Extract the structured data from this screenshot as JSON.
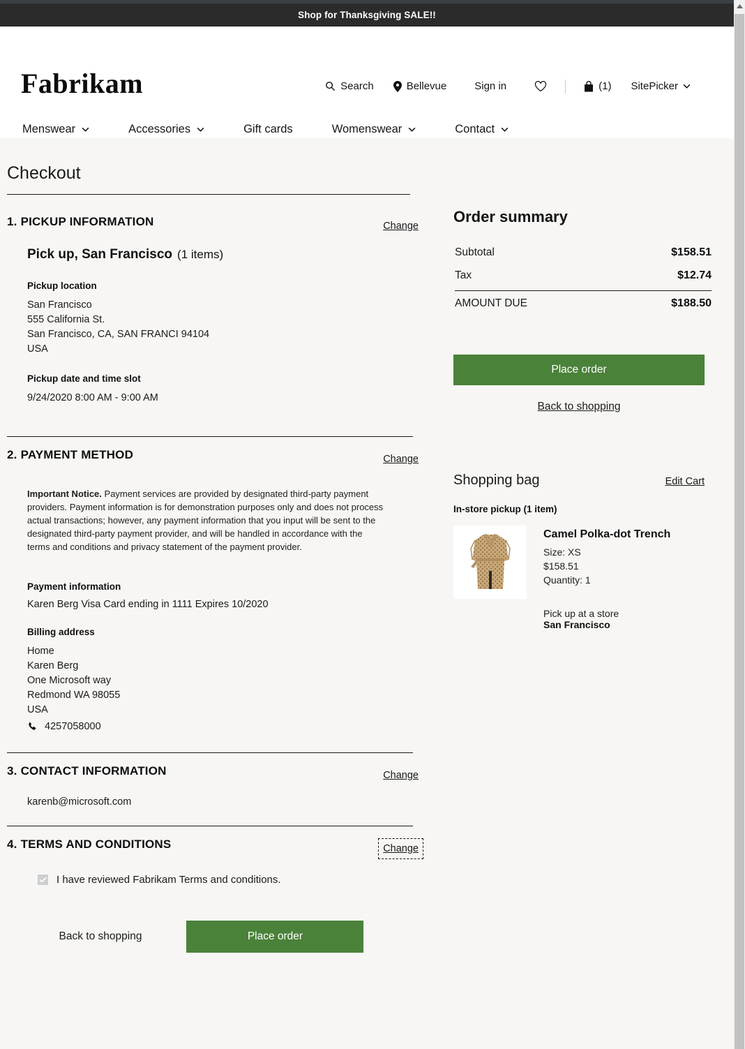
{
  "promo": {
    "text": "Shop for Thanksgiving SALE!!"
  },
  "header": {
    "logo": "Fabrikam",
    "utils": {
      "search": "Search",
      "location": "Bellevue",
      "signin": "Sign in",
      "cart_count": "(1)",
      "sitepicker": "SitePicker"
    },
    "nav": [
      {
        "label": "Menswear",
        "has_chevron": true
      },
      {
        "label": "Accessories",
        "has_chevron": true
      },
      {
        "label": "Gift cards",
        "has_chevron": false
      },
      {
        "label": "Womenswear",
        "has_chevron": true
      },
      {
        "label": "Contact",
        "has_chevron": true
      }
    ]
  },
  "checkout": {
    "title": "Checkout",
    "sections": {
      "pickup": {
        "number": "1.",
        "title": "PICKUP INFORMATION",
        "change": "Change",
        "heading": "Pick up, San Francisco",
        "items_count": "(1 items)",
        "location_label": "Pickup location",
        "location_lines": [
          "San Francisco",
          "555 California St.",
          "San Francisco, CA, SAN FRANCI 94104",
          "USA"
        ],
        "datetime_label": "Pickup date and time slot",
        "datetime_value": "9/24/2020 8:00 AM - 9:00 AM"
      },
      "payment": {
        "number": "2.",
        "title": "PAYMENT METHOD",
        "change": "Change",
        "notice_bold": "Important Notice.",
        "notice_body": " Payment services are provided by designated third-party payment providers.  Payment information is for demonstration purposes only and does not process actual transactions; however, any payment information that you input will be sent to the designated third-party payment provider, and will be handled in accordance with the terms and conditions and privacy statement of the payment provider.",
        "info_label": "Payment information",
        "info_value": "Karen Berg   Visa   Card ending in 1111   Expires 10/2020",
        "billing_label": "Billing address",
        "billing_lines": [
          "Home",
          "Karen Berg",
          "One Microsoft way",
          "Redmond WA   98055",
          "USA"
        ],
        "phone": "4257058000"
      },
      "contact": {
        "number": "3.",
        "title": "CONTACT INFORMATION",
        "change": "Change",
        "email": "karenb@microsoft.com"
      },
      "terms": {
        "number": "4.",
        "title": "TERMS AND CONDITIONS",
        "change": "Change",
        "checkbox_label": "I have reviewed Fabrikam Terms and conditions.",
        "checkbox_checked": true
      }
    },
    "bottom_actions": {
      "back": "Back to shopping",
      "place_order": "Place order"
    }
  },
  "order_summary": {
    "title": "Order summary",
    "rows": [
      {
        "label": "Subtotal",
        "value": "$158.51"
      },
      {
        "label": "Tax",
        "value": "$12.74"
      }
    ],
    "total": {
      "label": "AMOUNT DUE",
      "value": "$188.50"
    },
    "place_order": "Place order",
    "back_to_shopping": "Back to shopping"
  },
  "shopping_bag": {
    "title": "Shopping bag",
    "edit_cart": "Edit Cart",
    "group_label": "In-store pickup (1 item)",
    "item": {
      "name": "Camel Polka-dot Trench",
      "size": "Size: XS",
      "price": "$158.51",
      "quantity": "Quantity: 1",
      "pickup_note": "Pick up at a store",
      "pickup_store": "San Francisco"
    }
  },
  "colors": {
    "accent_green": "#4a8239",
    "banner_dark": "#2b2b2b",
    "page_bg": "#f7f6f4"
  }
}
